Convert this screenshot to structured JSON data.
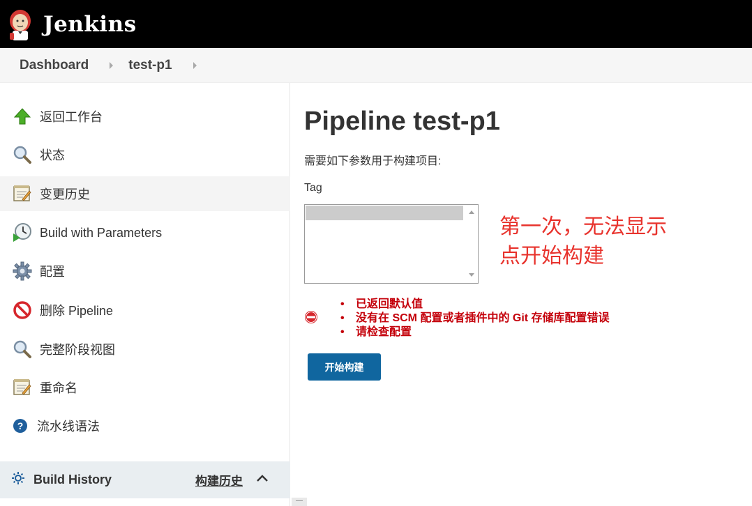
{
  "header": {
    "app_name": "Jenkins",
    "logo_icon": "jenkins-butler-icon"
  },
  "breadcrumb": {
    "items": [
      "Dashboard",
      "test-p1"
    ]
  },
  "sidebar": {
    "items": [
      {
        "label": "返回工作台",
        "icon": "up-arrow-icon"
      },
      {
        "label": "状态",
        "icon": "magnifier-icon"
      },
      {
        "label": "变更历史",
        "icon": "notepad-icon"
      },
      {
        "label": "Build with Parameters",
        "icon": "clock-play-icon"
      },
      {
        "label": "配置",
        "icon": "gear-icon"
      },
      {
        "label": "删除 Pipeline",
        "icon": "no-entry-icon"
      },
      {
        "label": "完整阶段视图",
        "icon": "magnifier-icon"
      },
      {
        "label": "重命名",
        "icon": "notepad-icon"
      },
      {
        "label": "流水线语法",
        "icon": "help-icon"
      }
    ],
    "build_history": {
      "title": "Build History",
      "cn_label": "构建历史"
    }
  },
  "main": {
    "title": "Pipeline test-p1",
    "description": "需要如下参数用于构建项目:",
    "param_label": "Tag",
    "note_lines": [
      "第一次，无法显示",
      "点开始构建"
    ],
    "errors": [
      "已返回默认值",
      "没有在 SCM 配置或者插件中的 Git 存储库配置错误",
      "请检查配置"
    ],
    "build_button": "开始构建"
  },
  "colors": {
    "header_bg": "#000000",
    "error_red": "#c4000a",
    "note_red": "#e8332d",
    "button_blue": "#10669f"
  }
}
